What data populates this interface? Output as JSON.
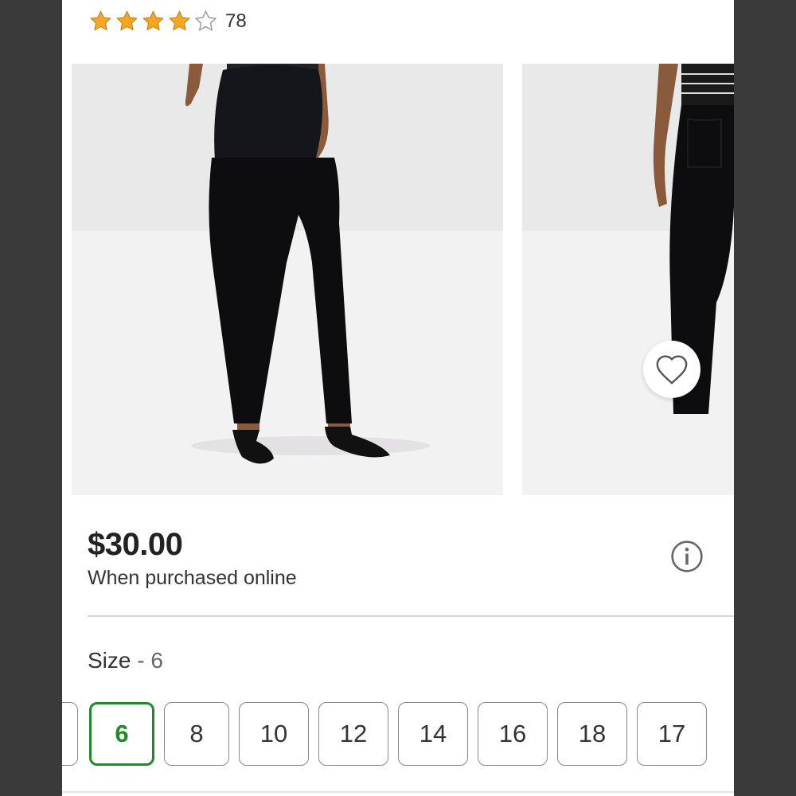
{
  "rating": {
    "stars": 4,
    "max_stars": 5,
    "count": "78"
  },
  "product": {
    "price": "$30.00",
    "price_note": "When purchased online"
  },
  "size": {
    "label": "Size",
    "separator": " - ",
    "selected": "6",
    "options": [
      "6",
      "8",
      "10",
      "12",
      "14",
      "16",
      "18",
      "17"
    ]
  },
  "colors": {
    "accent": "#1f8a2a",
    "star": "#f5a623"
  },
  "icons": [
    "star-icon",
    "heart-icon",
    "info-icon"
  ]
}
